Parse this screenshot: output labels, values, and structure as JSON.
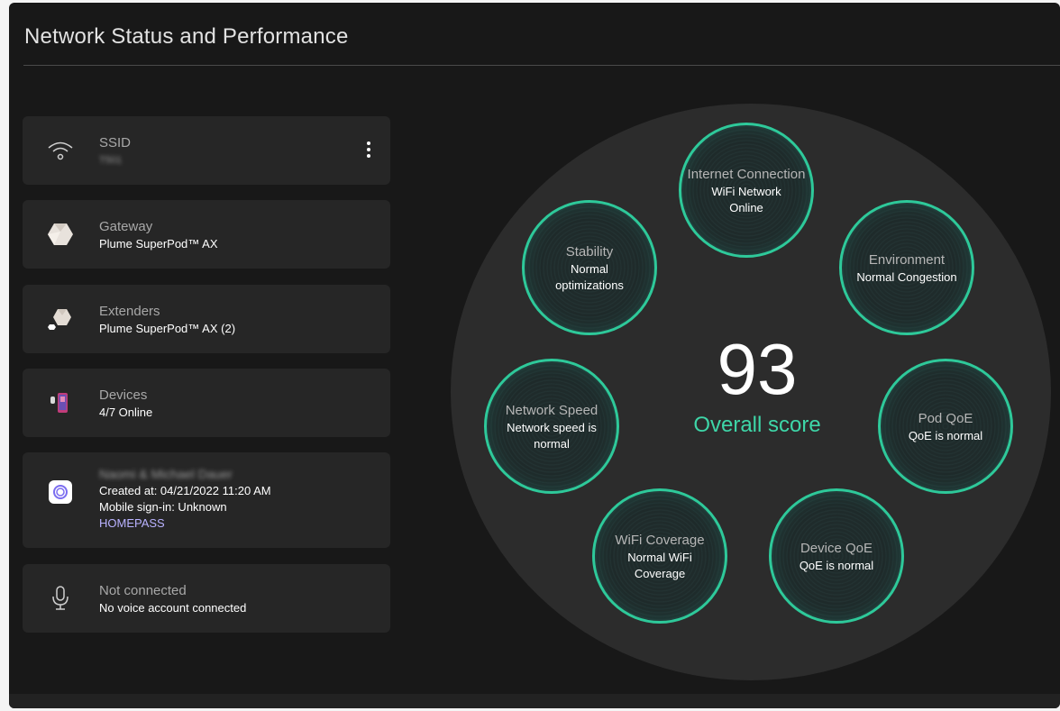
{
  "title": "Network Status and Performance",
  "cards": {
    "ssid": {
      "label": "SSID",
      "value": "T501"
    },
    "gateway": {
      "label": "Gateway",
      "value": "Plume SuperPod™ AX"
    },
    "extenders": {
      "label": "Extenders",
      "value": "Plume SuperPod™ AX (2)"
    },
    "devices": {
      "label": "Devices",
      "value": "4/7 Online"
    },
    "account": {
      "name": "Naomi & Michael Dauer",
      "created": "Created at: 04/21/2022 11:20 AM",
      "mobile": "Mobile sign-in: Unknown",
      "link": "HOMEPASS"
    },
    "voice": {
      "label": "Not connected",
      "value": "No voice account connected"
    }
  },
  "score": {
    "value": "93",
    "label": "Overall score"
  },
  "metrics": {
    "internet": {
      "title": "Internet Connection",
      "status": "WiFi Network Online"
    },
    "environment": {
      "title": "Environment",
      "status": "Normal Congestion"
    },
    "pod_qoe": {
      "title": "Pod QoE",
      "status": "QoE is normal"
    },
    "device_qoe": {
      "title": "Device QoE",
      "status": "QoE is normal"
    },
    "wifi_coverage": {
      "title": "WiFi Coverage",
      "status": "Normal WiFi Coverage"
    },
    "network_speed": {
      "title": "Network Speed",
      "status": "Network speed is normal"
    },
    "stability": {
      "title": "Stability",
      "status": "Normal optimizations"
    }
  },
  "colors": {
    "accent": "#2ec99a",
    "panel": "#181818",
    "card": "#262626",
    "link": "#b9b2ff"
  }
}
